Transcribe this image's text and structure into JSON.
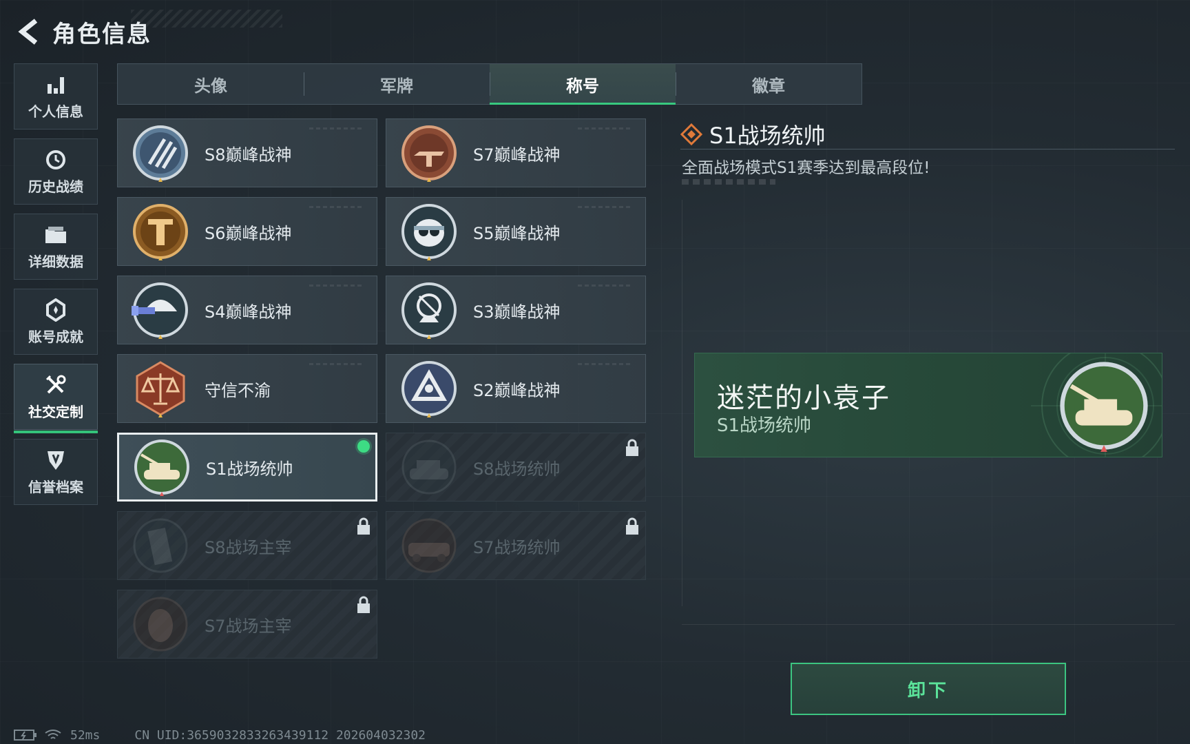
{
  "header": {
    "title": "角色信息"
  },
  "sidebar": {
    "items": [
      {
        "label": "个人信息",
        "icon": "bar-chart-icon"
      },
      {
        "label": "历史战绩",
        "icon": "history-clock-icon"
      },
      {
        "label": "详细数据",
        "icon": "folder-icon"
      },
      {
        "label": "账号成就",
        "icon": "achievement-icon"
      },
      {
        "label": "社交定制",
        "icon": "tools-icon",
        "active": true
      },
      {
        "label": "信誉档案",
        "icon": "shield-badge-icon"
      }
    ]
  },
  "tabs": [
    {
      "label": "头像"
    },
    {
      "label": "军牌"
    },
    {
      "label": "称号",
      "active": true
    },
    {
      "label": "徽章"
    }
  ],
  "cards": [
    {
      "label": "S8巅峰战神",
      "locked": false
    },
    {
      "label": "S7巅峰战神",
      "locked": false
    },
    {
      "label": "S6巅峰战神",
      "locked": false
    },
    {
      "label": "S5巅峰战神",
      "locked": false
    },
    {
      "label": "S4巅峰战神",
      "locked": false
    },
    {
      "label": "S3巅峰战神",
      "locked": false
    },
    {
      "label": "守信不渝",
      "locked": false
    },
    {
      "label": "S2巅峰战神",
      "locked": false
    },
    {
      "label": "S1战场统帅",
      "locked": false,
      "selected": true,
      "equipped": true
    },
    {
      "label": "S8战场统帅",
      "locked": true
    },
    {
      "label": "S8战场主宰",
      "locked": true
    },
    {
      "label": "S7战场统帅",
      "locked": true
    },
    {
      "label": "S7战场主宰",
      "locked": true
    }
  ],
  "detail": {
    "title": "S1战场统帅",
    "description": "全面战场模式S1赛季达到最高段位!"
  },
  "preview": {
    "player_name": "迷茫的小袁子",
    "title": "S1战场统帅"
  },
  "actions": {
    "unequip_label": "卸下"
  },
  "status": {
    "ping": "52ms",
    "uid": "CN UID:3659032833263439112 202604032302"
  },
  "colors": {
    "accent_green": "#38c97f",
    "preview_bg": "#264838",
    "text_primary": "#e4eaee"
  }
}
